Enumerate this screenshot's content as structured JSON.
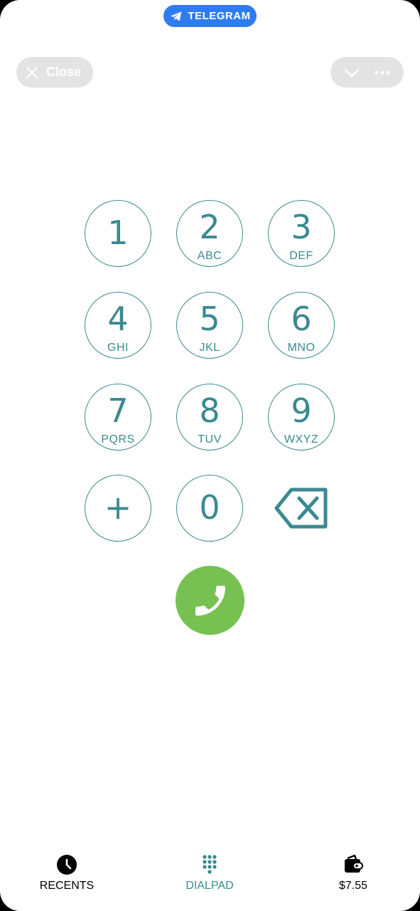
{
  "header": {
    "app_badge": "TELEGRAM",
    "close_label": "Close",
    "badge_color": "#2f7bf0"
  },
  "keypad": {
    "accent_color": "#3a8a8f",
    "keys": [
      {
        "digit": "1",
        "letters": ""
      },
      {
        "digit": "2",
        "letters": "ABC"
      },
      {
        "digit": "3",
        "letters": "DEF"
      },
      {
        "digit": "4",
        "letters": "GHI"
      },
      {
        "digit": "5",
        "letters": "JKL"
      },
      {
        "digit": "6",
        "letters": "MNO"
      },
      {
        "digit": "7",
        "letters": "PQRS"
      },
      {
        "digit": "8",
        "letters": "TUV"
      },
      {
        "digit": "9",
        "letters": "WXYZ"
      },
      {
        "digit": "+",
        "letters": ""
      },
      {
        "digit": "0",
        "letters": ""
      }
    ],
    "backspace_icon": "backspace-icon",
    "call_icon": "phone-icon",
    "call_color": "#77c152"
  },
  "bottom_nav": {
    "items": [
      {
        "label": "RECENTS",
        "icon": "clock-icon"
      },
      {
        "label": "DIALPAD",
        "icon": "dialpad-icon",
        "active": true
      },
      {
        "label": "$7.55",
        "icon": "wallet-icon"
      }
    ],
    "active_color": "#3a8a8f"
  }
}
